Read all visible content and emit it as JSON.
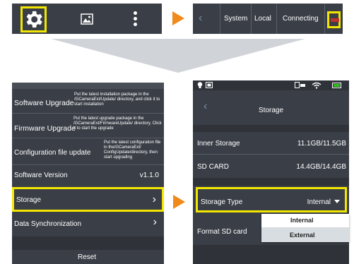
{
  "top_right_bar": {
    "items": [
      "System",
      "Local",
      "Connecting"
    ]
  },
  "left_panel": {
    "rows": [
      {
        "title": "Software Upgrade",
        "desc": "Put the latest installation package in the /GCameraExt/Update/ directory, and click it to start installation"
      },
      {
        "title": "Firmware Upgrade",
        "desc": "Put the latest upgrade package in the /GCameraExt/FirmwareUpdate/ directory, Click it to start the upgrade"
      },
      {
        "title": "Configuration file update",
        "desc": "Put the latest configuration file in the/GCameraExt/ ConfigUpdate/directory, then start upgrading"
      },
      {
        "title": "Software Version",
        "value": "v1.1.0"
      },
      {
        "title": "Storage"
      },
      {
        "title": "Data Synchronization"
      }
    ],
    "reset": "Reset"
  },
  "right_panel": {
    "title": "Storage",
    "inner_storage_label": "Inner Storage",
    "inner_storage_value": "11.1GB/11.5GB",
    "sd_card_label": "SD CARD",
    "sd_card_value": "14.4GB/14.4GB",
    "storage_type_label": "Storage Type",
    "storage_type_value": "Internal",
    "format_label": "Format SD card",
    "dropdown": [
      "Internal",
      "External"
    ]
  },
  "colors": {
    "panel_bg": "#3a3f47",
    "highlight": "#f2e600",
    "arrow": "#f08a1a",
    "big_arrow": "#d0d3d8"
  }
}
